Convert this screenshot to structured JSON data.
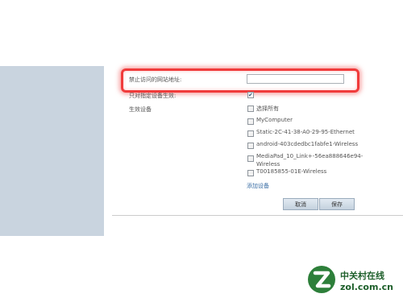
{
  "form": {
    "url_label": "禁止访问的网站地址:",
    "url_value": "",
    "only_devices_label": "只对指定设备生效:",
    "only_devices_checked": true,
    "effective_devices_label": "生效设备",
    "select_all_label": "选择所有",
    "devices": [
      "MyComputer",
      "Static-2C-41-38-A0-29-95-Ethernet",
      "android-403cdedbc1fabfe1-Wireless",
      "MediaPad_10_Link+-56ea888646e94-",
      "Wireless",
      "T00185855-01E-Wireless"
    ],
    "add_device_link": "添加设备",
    "cancel_label": "取消",
    "save_label": "保存"
  },
  "watermark": {
    "name_cn": "中关村在线",
    "name_en": "zol.com.cn"
  }
}
